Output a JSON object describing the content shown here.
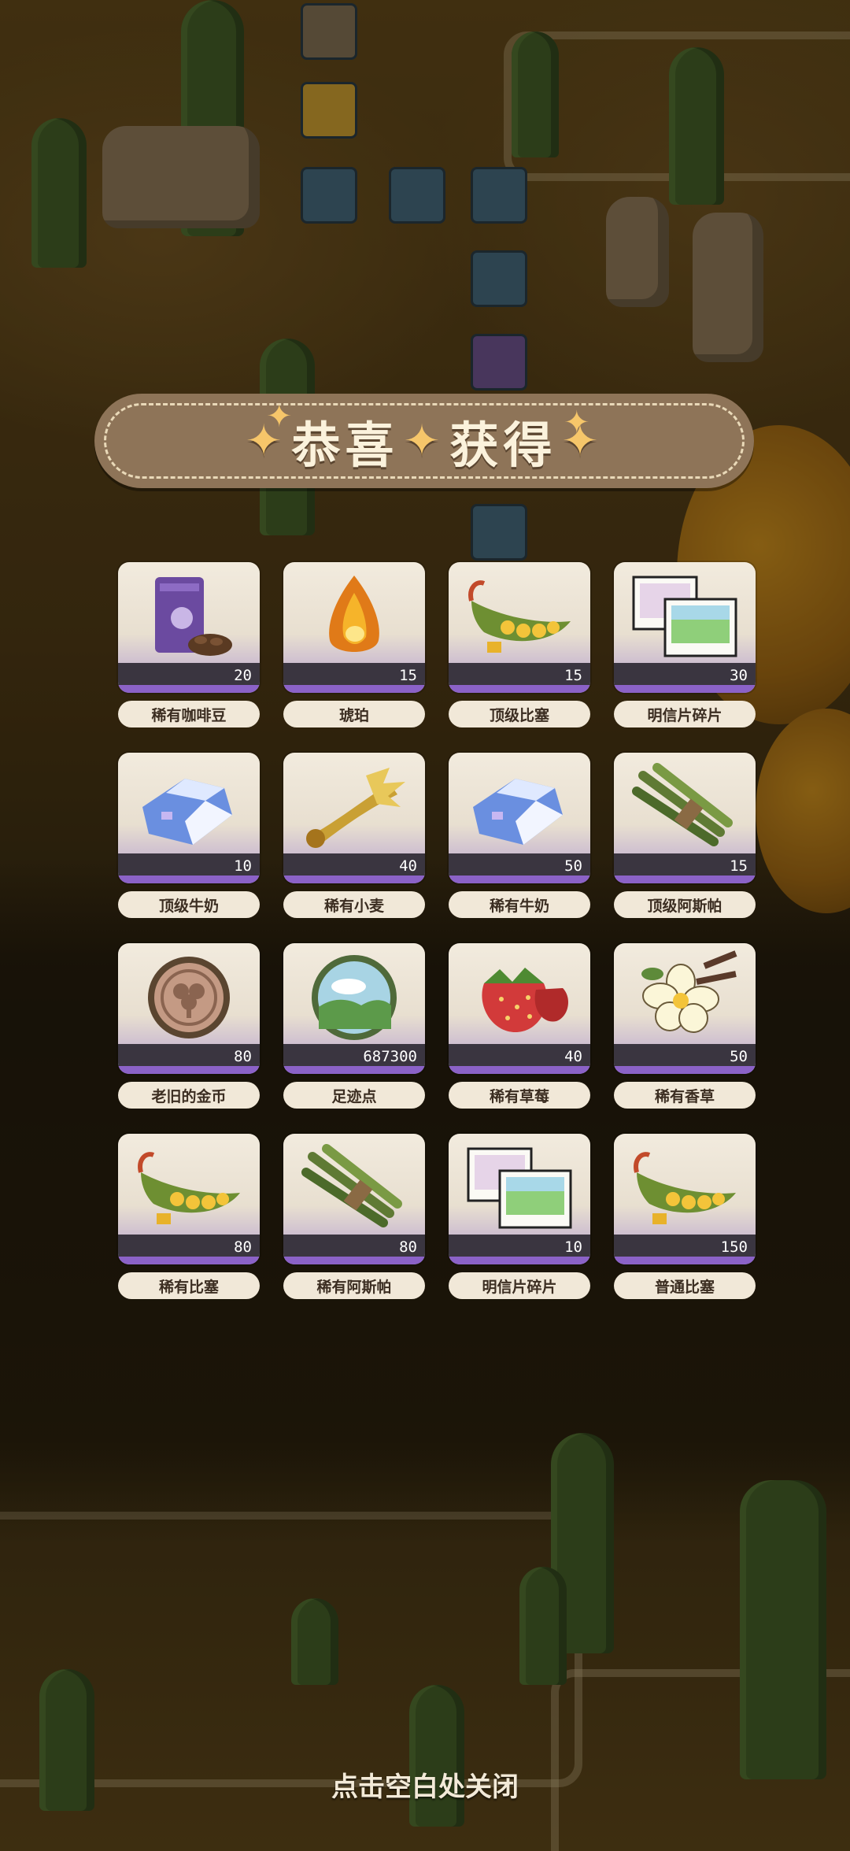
{
  "banner": {
    "title_left": "恭喜",
    "title_right": "获得"
  },
  "rewards": [
    {
      "name": "稀有咖啡豆",
      "count": "20",
      "icon": "coffee-bean-bag-icon"
    },
    {
      "name": "琥珀",
      "count": "15",
      "icon": "amber-icon"
    },
    {
      "name": "顶级比塞",
      "count": "15",
      "icon": "bean-pod-icon"
    },
    {
      "name": "明信片碎片",
      "count": "30",
      "icon": "postcard-icon"
    },
    {
      "name": "顶级牛奶",
      "count": "10",
      "icon": "milk-carton-icon"
    },
    {
      "name": "稀有小麦",
      "count": "40",
      "icon": "wheat-icon"
    },
    {
      "name": "稀有牛奶",
      "count": "50",
      "icon": "milk-carton-icon"
    },
    {
      "name": "顶级阿斯帕",
      "count": "15",
      "icon": "asparagus-icon"
    },
    {
      "name": "老旧的金币",
      "count": "80",
      "icon": "old-coin-icon"
    },
    {
      "name": "足迹点",
      "count": "687300",
      "icon": "footprint-orb-icon"
    },
    {
      "name": "稀有草莓",
      "count": "40",
      "icon": "strawberry-icon"
    },
    {
      "name": "稀有香草",
      "count": "50",
      "icon": "vanilla-flower-icon"
    },
    {
      "name": "稀有比塞",
      "count": "80",
      "icon": "bean-pod-icon"
    },
    {
      "name": "稀有阿斯帕",
      "count": "80",
      "icon": "asparagus-icon"
    },
    {
      "name": "明信片碎片",
      "count": "10",
      "icon": "postcard-icon"
    },
    {
      "name": "普通比塞",
      "count": "150",
      "icon": "bean-pod-icon"
    }
  ],
  "close_hint": "点击空白处关闭",
  "colors": {
    "card_accent": "#8b62c7",
    "count_bar": "#3a3540",
    "banner": "#8e7458"
  }
}
